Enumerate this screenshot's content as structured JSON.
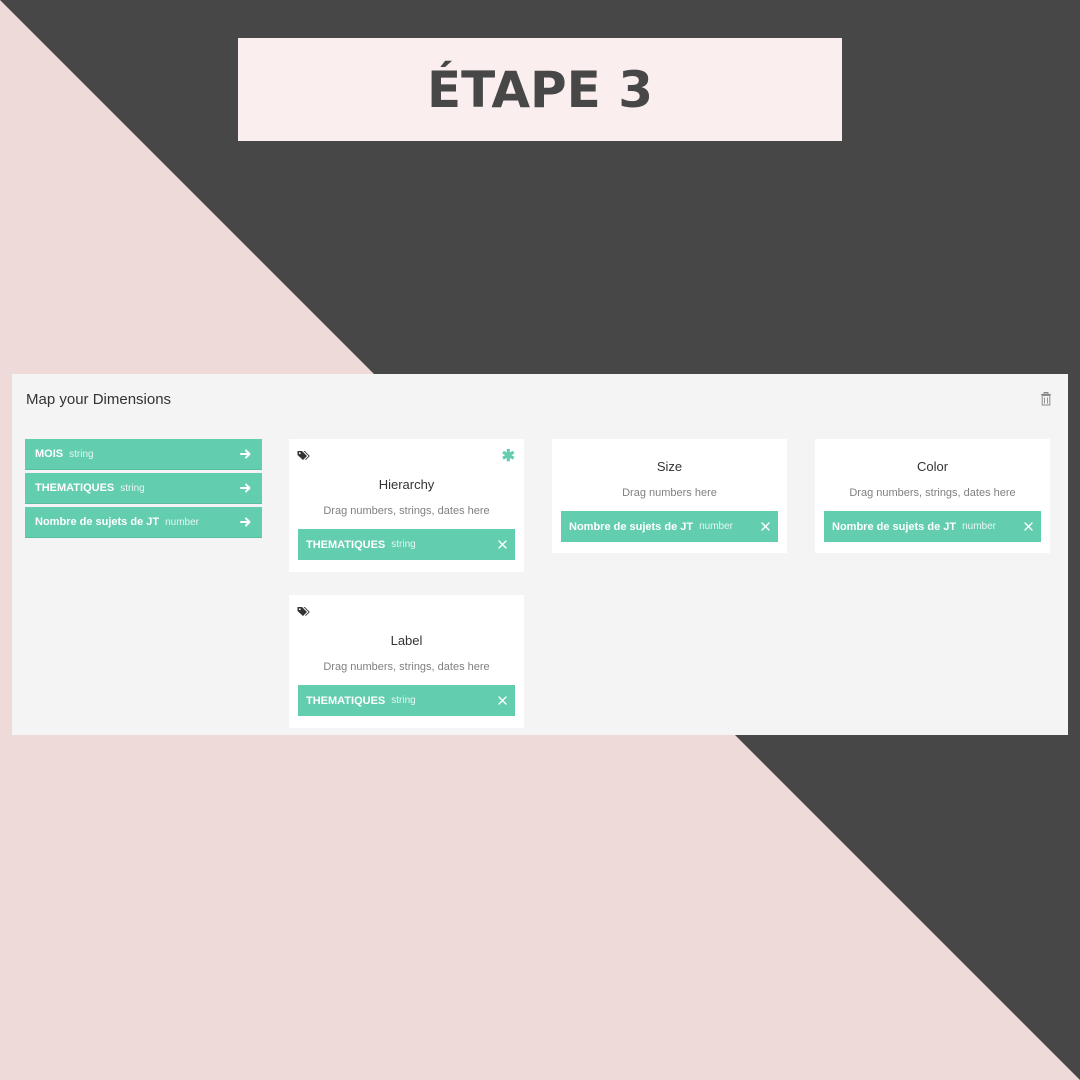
{
  "colors": {
    "background_pink": "#efdada",
    "background_dark": "#474747",
    "title_box": "#faeeee",
    "title_text": "#474747",
    "panel": "#f4f4f4",
    "accent": "#63cdaf",
    "card": "#ffffff"
  },
  "header": {
    "title": "ÉTAPE 3"
  },
  "panel": {
    "title": "Map your Dimensions",
    "trash_icon": "trash-icon"
  },
  "dimensions": [
    {
      "name": "MOIS",
      "type": "string",
      "icon": "arrow-right-icon"
    },
    {
      "name": "THEMATIQUES",
      "type": "string",
      "icon": "arrow-right-icon"
    },
    {
      "name": "Nombre de sujets de JT",
      "type": "number",
      "icon": "arrow-right-icon"
    }
  ],
  "cards": {
    "hierarchy": {
      "title": "Hierarchy",
      "hint": "Drag numbers, strings, dates here",
      "icon": "tag-icon",
      "required_icon": "asterisk-icon",
      "required_symbol": "✱",
      "chip": {
        "name": "THEMATIQUES",
        "type": "string",
        "remove_icon": "close-icon"
      }
    },
    "size": {
      "title": "Size",
      "hint": "Drag numbers here",
      "chip": {
        "name": "Nombre de sujets de JT",
        "type": "number",
        "remove_icon": "close-icon"
      }
    },
    "color": {
      "title": "Color",
      "hint": "Drag numbers, strings, dates here",
      "chip": {
        "name": "Nombre de sujets de JT",
        "type": "number",
        "remove_icon": "close-icon"
      }
    },
    "label": {
      "title": "Label",
      "hint": "Drag numbers, strings, dates here",
      "icon": "tag-icon",
      "chip": {
        "name": "THEMATIQUES",
        "type": "string",
        "remove_icon": "close-icon"
      }
    }
  }
}
